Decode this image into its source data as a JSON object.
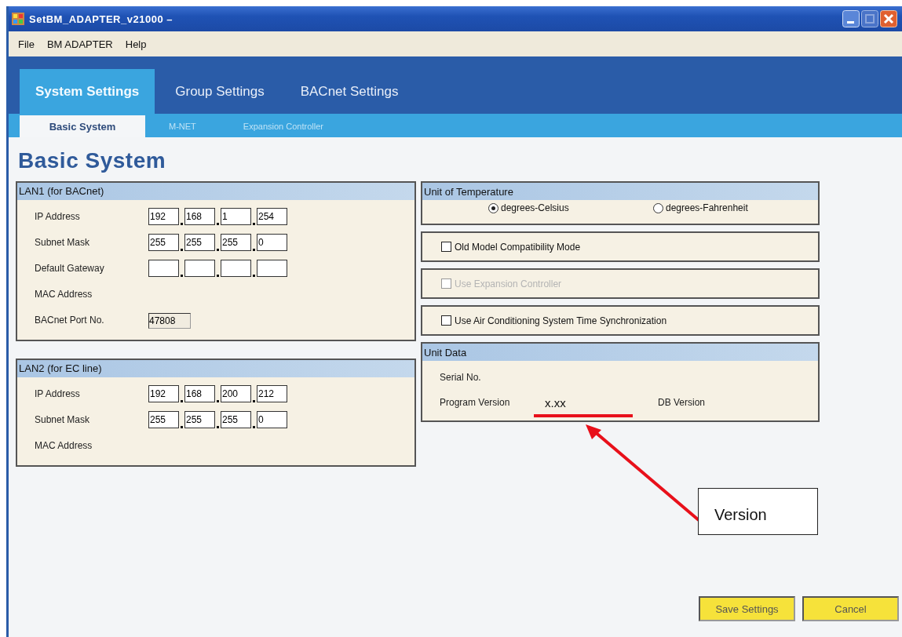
{
  "window": {
    "title": "SetBM_ADAPTER_v21000 –"
  },
  "menu": [
    {
      "label": "File"
    },
    {
      "label": "BM ADAPTER"
    },
    {
      "label": "Help"
    }
  ],
  "tabs": [
    {
      "label": "System Settings",
      "selected": true
    },
    {
      "label": "Group Settings",
      "selected": false
    },
    {
      "label": "BACnet Settings",
      "selected": false
    }
  ],
  "subtabs": [
    {
      "label": "Basic System",
      "selected": true
    },
    {
      "label": "M-NET",
      "selected": false
    },
    {
      "label": "Expansion Controller",
      "selected": false
    }
  ],
  "heading": "Basic System",
  "lan_groups": [
    {
      "title": "LAN1 (for BACnet)",
      "rows": [
        {
          "label": "IP Address",
          "kind": "ip",
          "octets": [
            "192",
            "168",
            "1",
            "254"
          ]
        },
        {
          "label": "Subnet Mask",
          "kind": "ip",
          "octets": [
            "255",
            "255",
            "255",
            "0"
          ]
        },
        {
          "label": "Default Gateway",
          "kind": "ip"
        },
        {
          "label": "MAC Address",
          "kind": "text"
        },
        {
          "label": "BACnet Port No.",
          "kind": "field",
          "value": "47808"
        }
      ]
    },
    {
      "title": "LAN2 (for EC line)",
      "rows": [
        {
          "label": "IP Address",
          "kind": "ip",
          "octets": [
            "192",
            "168",
            "200",
            "212"
          ]
        },
        {
          "label": "Subnet Mask",
          "kind": "ip",
          "octets": [
            "255",
            "255",
            "255",
            "0"
          ]
        },
        {
          "label": "MAC Address",
          "kind": "text"
        }
      ]
    }
  ],
  "temperature": {
    "title": "Unit of Temperature",
    "options": [
      {
        "label": "degrees-Celsius",
        "selected": true
      },
      {
        "label": "degrees-Fahrenheit",
        "selected": false
      }
    ]
  },
  "options": [
    {
      "label": "Old Model Compatibility Mode",
      "checked": false,
      "disabled": false
    },
    {
      "label": "Use Expansion Controller",
      "checked": false,
      "disabled": true
    },
    {
      "label": "Use Air Conditioning System Time Synchronization",
      "checked": false,
      "disabled": false
    }
  ],
  "unit_data": {
    "title": "Unit Data",
    "serial_label": "Serial No.",
    "program_version_label": "Program Version",
    "program_version_value": "x.xx",
    "db_version_label": "DB Version"
  },
  "annotation": {
    "callout": "Version"
  },
  "buttons": [
    {
      "label": "Save Settings"
    },
    {
      "label": "Cancel"
    }
  ]
}
